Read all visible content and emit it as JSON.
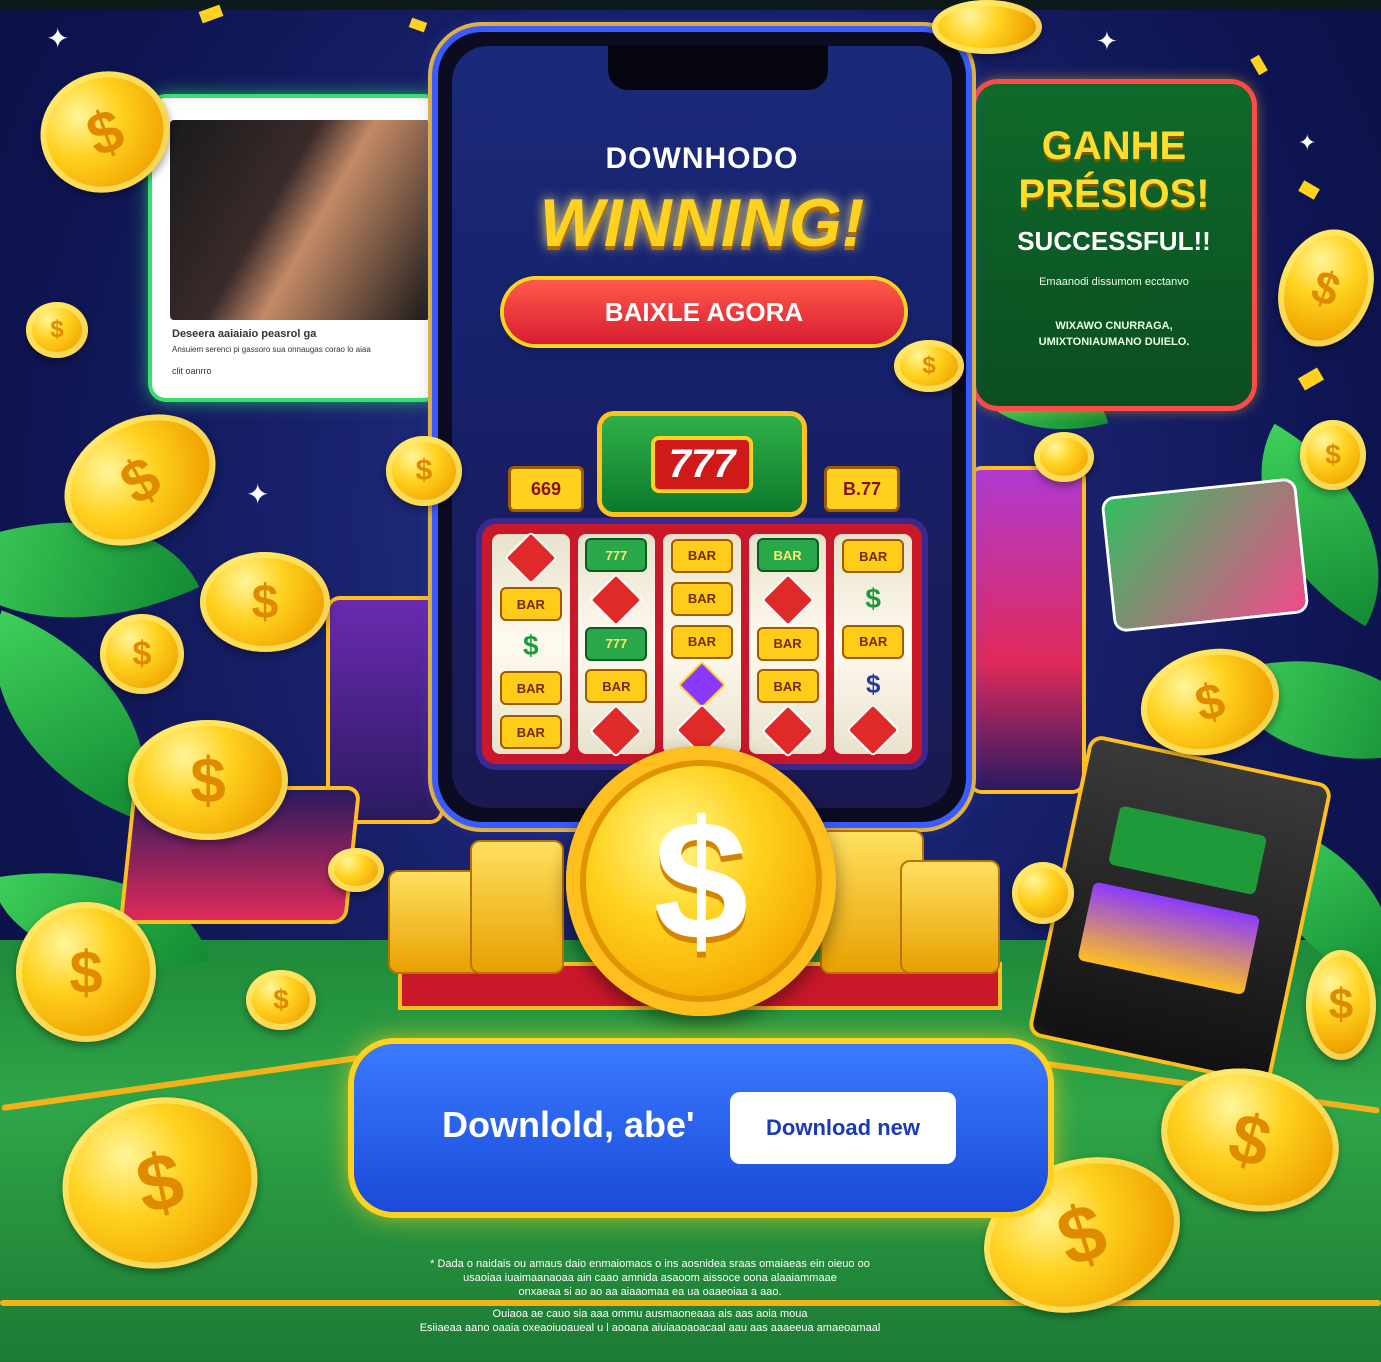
{
  "top_strip": {
    "text": ""
  },
  "left_card": {
    "caption_line1": "Deseera aaiaiaio peasrol ga",
    "caption_line2": "Ansuiem serenci pi gassoro sua onnaugas corao lo aiaa",
    "caption_line3": "clit oanrro"
  },
  "phone": {
    "subtitle": "DOWNHODO",
    "title": "WINNING!",
    "cta": "BAIXLE AGORA",
    "marquee_badge": "777",
    "plate_left": "669",
    "plate_right": "B.77"
  },
  "right_card": {
    "title_line1": "GANHE",
    "title_line2": "PRÉSIOS!",
    "subtitle": "SUCCESSFUL!!",
    "small_line1": "Emaanodi dissumom ecctanvo",
    "small_line2": "WIXAWO CNURRAGA,",
    "small_line3": "UMIXTONIAUMANO DUIELO."
  },
  "banner": {
    "text": "Downlold, abe'",
    "button": "Download new"
  },
  "fine_print": {
    "line1": "* Dada o naidais ou amaus daio enmaiomaos o ins aosnidea sraas omaiaeas ein oieuo oo",
    "line2": "usaoiaa iuaimaanaoaa ain caao amnida asaoom aissoce oona alaaiammaae",
    "line3": "onxaeaa si   ao ao  aa aiaaomaa ea ua oaaeoiaa a aao.",
    "line4": "Ouiaoa ae cauo sia aaa ommu ausmaoneaaa ais aas aoia moua",
    "line5": "Esiiaeaa aano oaaia oxeaoiuoaueal u l aooana aiuiaaoaoacaal aau aas aaaeeua amaeoamaal"
  },
  "colors": {
    "gold": "#ffd21f",
    "neon_blue": "#3a5cff",
    "neon_green": "#36e06a",
    "cta_red": "#d91c32",
    "banner_blue": "#1a4ad8"
  },
  "icons": [
    "dollar-coin-icon",
    "sparkle-icon",
    "confetti-icon",
    "diamond-symbol-icon"
  ]
}
